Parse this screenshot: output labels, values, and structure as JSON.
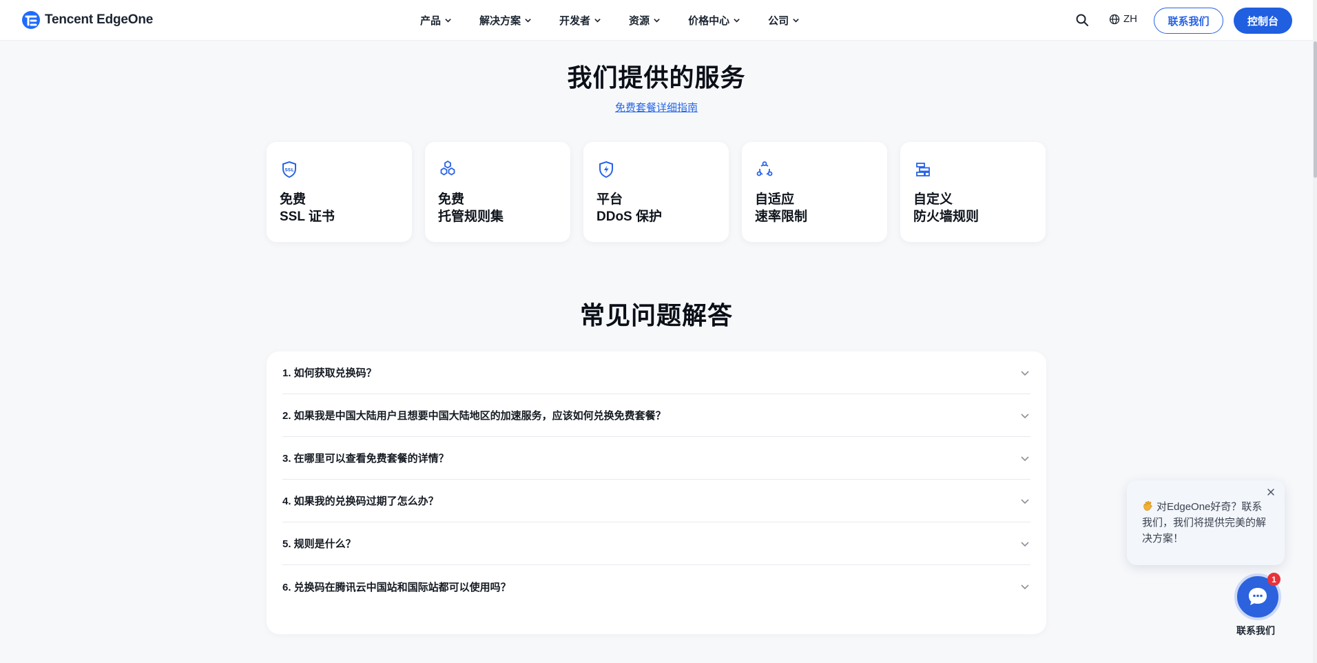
{
  "header": {
    "brand": "Tencent EdgeOne",
    "nav": [
      "产品",
      "解决方案",
      "开发者",
      "资源",
      "价格中心",
      "公司"
    ],
    "lang": "ZH",
    "contact_label": "联系我们",
    "console_label": "控制台"
  },
  "services": {
    "title": "我们提供的服务",
    "guide_link": "免费套餐详细指南",
    "cards": [
      {
        "line1": "免费",
        "line2": "SSL 证书",
        "icon": "ssl-shield-icon"
      },
      {
        "line1": "免费",
        "line2": "托管规则集",
        "icon": "hexagon-cluster-icon"
      },
      {
        "line1": "平台",
        "line2": "DDoS 保护",
        "icon": "shield-bolt-icon"
      },
      {
        "line1": "自适应",
        "line2": "速率限制",
        "icon": "cycle-nodes-icon"
      },
      {
        "line1": "自定义",
        "line2": "防火墙规则",
        "icon": "firewall-bricks-icon"
      }
    ]
  },
  "faq": {
    "title": "常见问题解答",
    "items": [
      "1. 如何获取兑换码？",
      "2. 如果我是中国大陆用户且想要中国大陆地区的加速服务，应该如何兑换免费套餐？",
      "3. 在哪里可以查看免费套餐的详情？",
      "4. 如果我的兑换码过期了怎么办？",
      "5. 规则是什么？",
      "6. 兑换码在腾讯云中国站和国际站都可以使用吗？"
    ]
  },
  "chat": {
    "message": "对EdgeOne好奇？联系我们，我们将提供完美的解决方案！",
    "badge": "1",
    "label": "联系我们"
  },
  "colors": {
    "accent": "#1f5fe0",
    "link": "#2466e6",
    "badge": "#e8323b"
  }
}
